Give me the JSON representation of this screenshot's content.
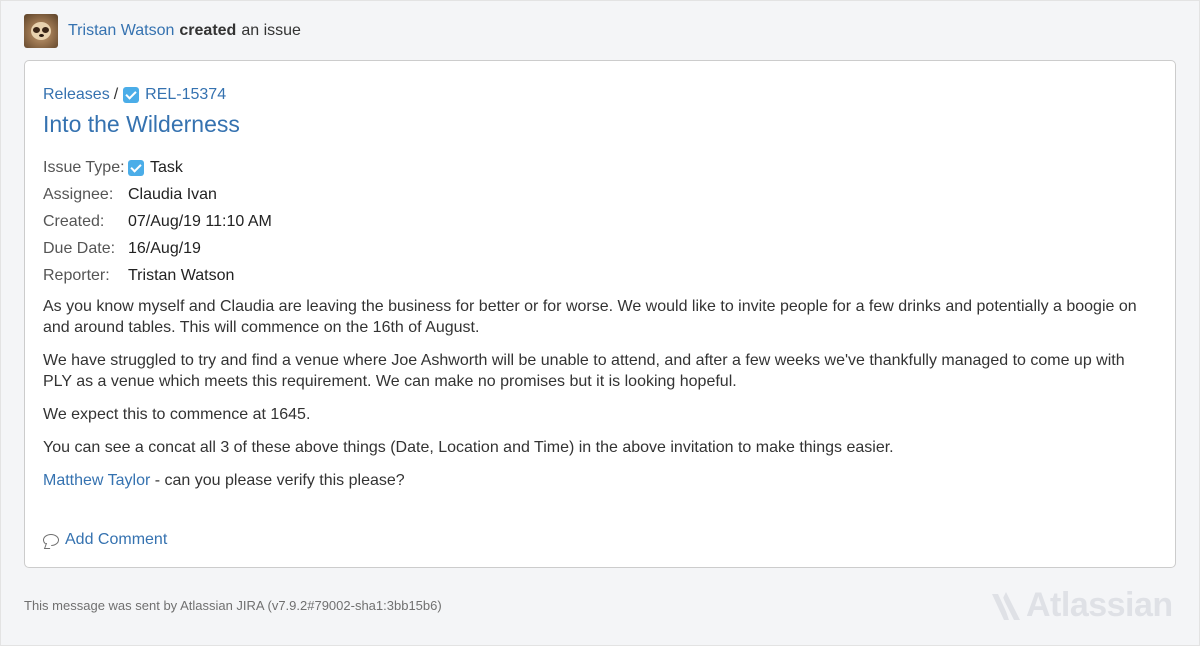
{
  "header": {
    "author": "Tristan Watson",
    "action": "created",
    "object": "an issue"
  },
  "issue": {
    "project": "Releases",
    "breadcrumb_separator": "/",
    "key": "REL-15374",
    "title": "Into the Wilderness",
    "fields": [
      {
        "label": "Issue Type:",
        "value": "Task",
        "icon": "task-checkbox-icon"
      },
      {
        "label": "Assignee:",
        "value": "Claudia Ivan",
        "link": true
      },
      {
        "label": "Created:",
        "value": "07/Aug/19 11:10 AM"
      },
      {
        "label": "Due Date:",
        "value": "16/Aug/19"
      },
      {
        "label": "Reporter:",
        "value": "Tristan Watson",
        "link": true
      }
    ],
    "description": {
      "p1": "As you know myself and Claudia are leaving the business for better or for worse. We would like to invite people for a few drinks and potentially a boogie on and around tables. This will commence on the 16th of August.",
      "p2": "We have struggled to try and find a venue where Joe Ashworth will be unable to attend, and after a few weeks we've thankfully managed to come up with PLY as a venue which meets this requirement. We can make no promises but it is looking hopeful.",
      "p3": "We expect this to commence at 1645.",
      "p4": "You can see a concat all 3 of these above things (Date, Location and Time) in the above invitation to make things easier.",
      "mention": "Matthew Taylor",
      "p5_rest": " - can you please verify this please?"
    },
    "add_comment_label": "Add Comment"
  },
  "footer": {
    "text": "This message was sent by Atlassian JIRA (v7.9.2#79002-sha1:3bb15b6)",
    "logo_text": "Atlassian"
  },
  "colors": {
    "link": "#3572b0",
    "task_icon": "#4bade8",
    "background": "#f4f5f7"
  }
}
